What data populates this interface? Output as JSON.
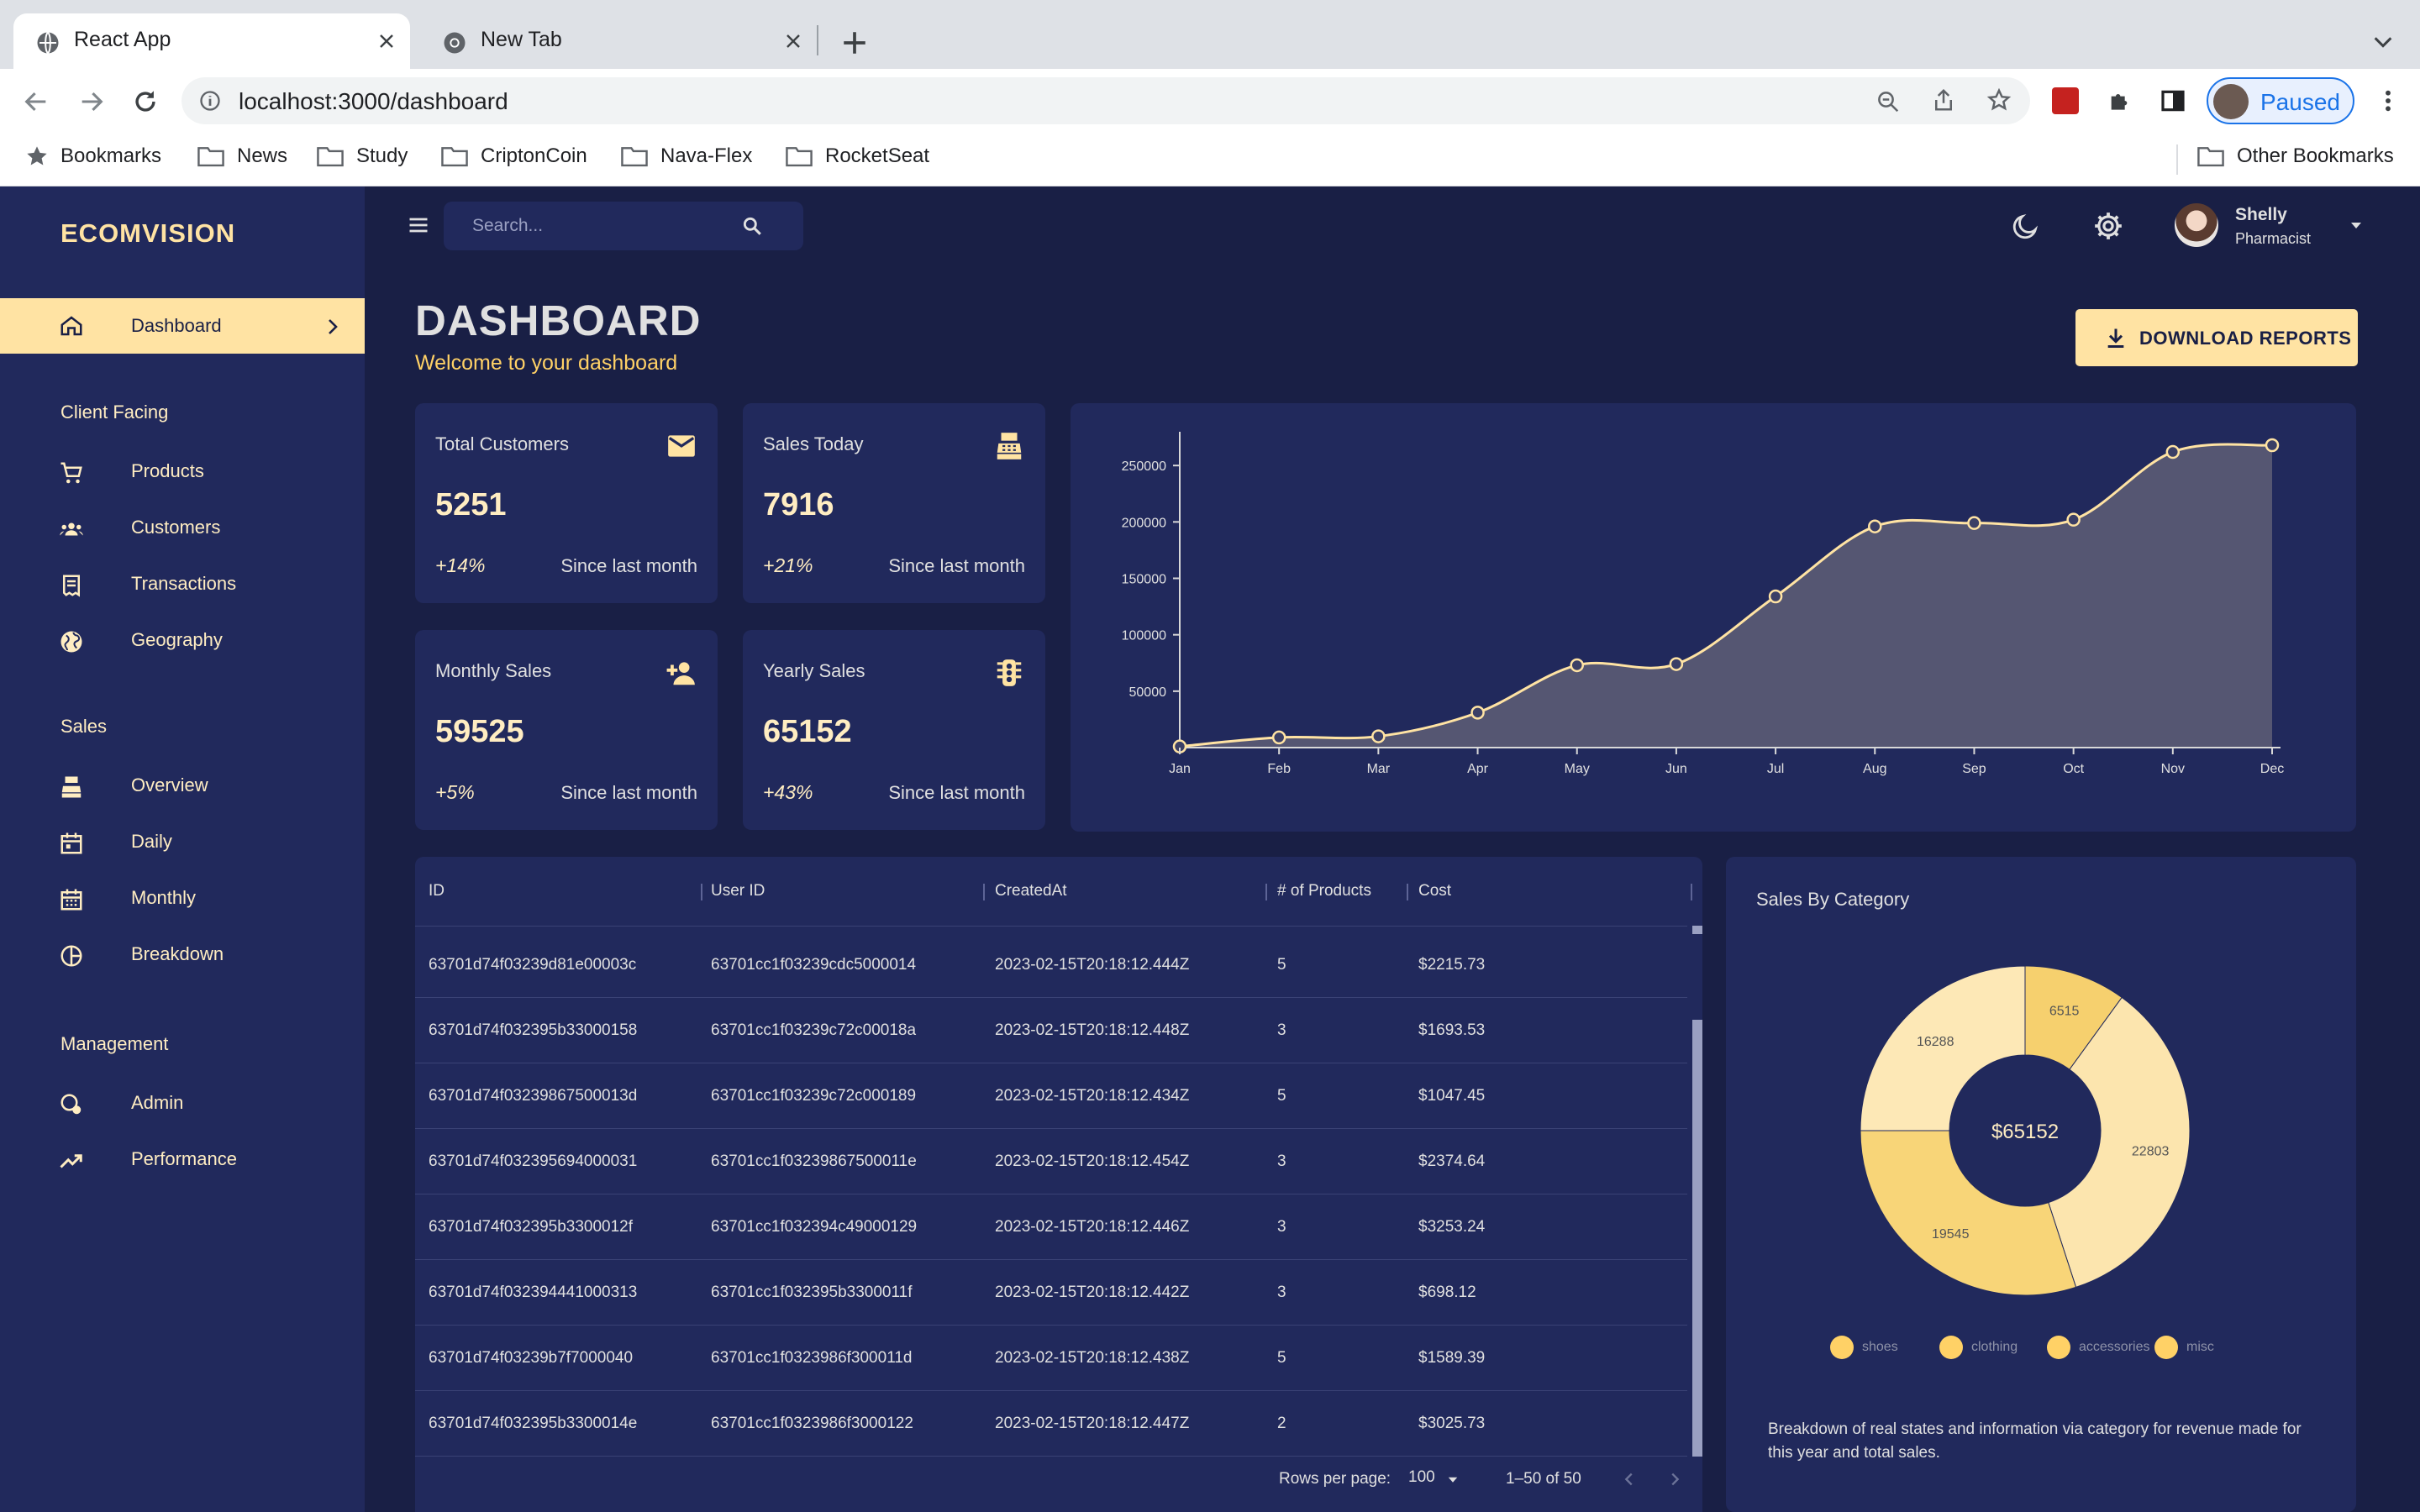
{
  "browser": {
    "tabs": [
      {
        "title": "React App",
        "active": true
      },
      {
        "title": "New Tab",
        "active": false
      }
    ],
    "url": "localhost:3000/dashboard",
    "profile_status": "Paused",
    "bookmarks": [
      "Bookmarks",
      "News",
      "Study",
      "CriptonCoin",
      "Nava-Flex",
      "RocketSeat"
    ],
    "other_bookmarks": "Other Bookmarks"
  },
  "sidebar": {
    "brand": "ECOMVISION",
    "active_item": "Dashboard",
    "sections": [
      {
        "title": "Client Facing",
        "items": [
          "Products",
          "Customers",
          "Transactions",
          "Geography"
        ]
      },
      {
        "title": "Sales",
        "items": [
          "Overview",
          "Daily",
          "Monthly",
          "Breakdown"
        ]
      },
      {
        "title": "Management",
        "items": [
          "Admin",
          "Performance"
        ]
      }
    ]
  },
  "topbar": {
    "search_placeholder": "Search...",
    "user_name": "Shelly",
    "user_role": "Pharmacist"
  },
  "header": {
    "title": "DASHBOARD",
    "subtitle": "Welcome to your dashboard",
    "download_label": "DOWNLOAD REPORTS"
  },
  "stats": [
    {
      "title": "Total Customers",
      "value": "5251",
      "change": "+14%",
      "note": "Since last month",
      "icon": "email-icon"
    },
    {
      "title": "Sales Today",
      "value": "7916",
      "change": "+21%",
      "note": "Since last month",
      "icon": "point-of-sale-icon"
    },
    {
      "title": "Monthly Sales",
      "value": "59525",
      "change": "+5%",
      "note": "Since last month",
      "icon": "person-add-icon"
    },
    {
      "title": "Yearly Sales",
      "value": "65152",
      "change": "+43%",
      "note": "Since last month",
      "icon": "traffic-icon"
    }
  ],
  "table": {
    "columns": [
      "ID",
      "User ID",
      "CreatedAt",
      "# of Products",
      "Cost"
    ],
    "rows": [
      [
        "63701d74f03239d81e00003c",
        "63701cc1f03239cdc5000014",
        "2023-02-15T20:18:12.444Z",
        "5",
        "$2215.73"
      ],
      [
        "63701d74f032395b33000158",
        "63701cc1f03239c72c00018a",
        "2023-02-15T20:18:12.448Z",
        "3",
        "$1693.53"
      ],
      [
        "63701d74f03239867500013d",
        "63701cc1f03239c72c000189",
        "2023-02-15T20:18:12.434Z",
        "5",
        "$1047.45"
      ],
      [
        "63701d74f032395694000031",
        "63701cc1f03239867500011e",
        "2023-02-15T20:18:12.454Z",
        "3",
        "$2374.64"
      ],
      [
        "63701d74f032395b3300012f",
        "63701cc1f032394c49000129",
        "2023-02-15T20:18:12.446Z",
        "3",
        "$3253.24"
      ],
      [
        "63701d74f032394441000313",
        "63701cc1f032395b3300011f",
        "2023-02-15T20:18:12.442Z",
        "3",
        "$698.12"
      ],
      [
        "63701d74f03239b7f7000040",
        "63701cc1f0323986f300011d",
        "2023-02-15T20:18:12.438Z",
        "5",
        "$1589.39"
      ],
      [
        "63701d74f032395b3300014e",
        "63701cc1f0323986f3000122",
        "2023-02-15T20:18:12.447Z",
        "2",
        "$3025.73"
      ]
    ],
    "rows_per_page_label": "Rows per page:",
    "rows_per_page": "100",
    "range": "1–50 of 50"
  },
  "chart_data": [
    {
      "type": "area",
      "x": [
        "Jan",
        "Feb",
        "Mar",
        "Apr",
        "May",
        "Jun",
        "Jul",
        "Aug",
        "Sep",
        "Oct",
        "Nov",
        "Dec"
      ],
      "values": [
        1000,
        9000,
        10000,
        31000,
        73000,
        74000,
        134000,
        196000,
        199000,
        202000,
        262000,
        268000
      ],
      "yticks": [
        50000,
        100000,
        150000,
        200000,
        250000
      ],
      "ylim": [
        0,
        268000
      ],
      "grid": false,
      "color": "#ffe3a3"
    },
    {
      "type": "pie",
      "title": "Sales By Category",
      "center_label": "$65152",
      "slices": [
        {
          "name": "shoes",
          "value": 6515,
          "color": "#f6d06e"
        },
        {
          "name": "clothing",
          "value": 22803,
          "color": "#fce5ae"
        },
        {
          "name": "accessories",
          "value": 19545,
          "color": "#f8d578"
        },
        {
          "name": "misc",
          "value": 16288,
          "color": "#fde8b6"
        }
      ],
      "legend": [
        "shoes",
        "clothing",
        "accessories",
        "misc"
      ],
      "description": "Breakdown of real states and information via category for revenue made for this year and total sales."
    }
  ]
}
